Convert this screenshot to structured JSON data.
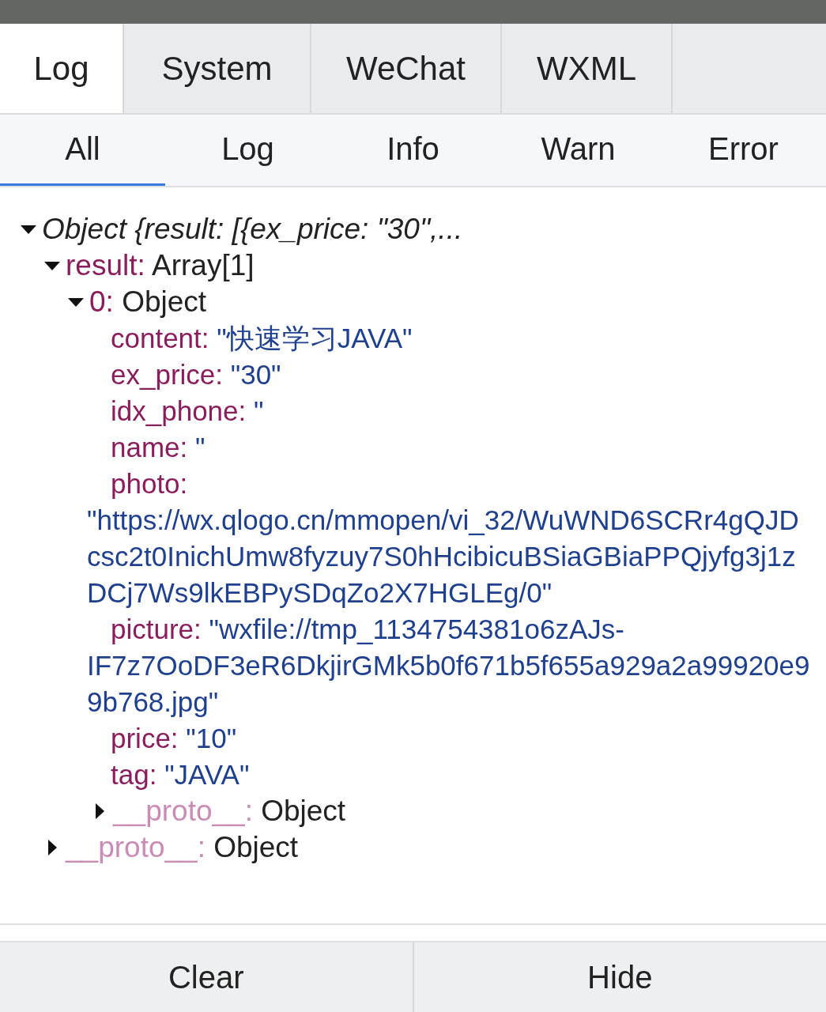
{
  "tabs": [
    {
      "label": "Log",
      "selected": true
    },
    {
      "label": "System",
      "selected": false
    },
    {
      "label": "WeChat",
      "selected": false
    },
    {
      "label": "WXML",
      "selected": false
    }
  ],
  "filters": [
    {
      "label": "All",
      "selected": true
    },
    {
      "label": "Log",
      "selected": false
    },
    {
      "label": "Info",
      "selected": false
    },
    {
      "label": "Warn",
      "selected": false
    },
    {
      "label": "Error",
      "selected": false
    }
  ],
  "console": [
    {
      "kind": "summary",
      "text": "Object {result: [{ex_price: \"30\",...",
      "expanded": true,
      "children": [
        {
          "kind": "object",
          "key": "result:",
          "value": "Array[1]",
          "expanded": true,
          "children": [
            {
              "kind": "object",
              "key": "0:",
              "value": "Object",
              "expanded": true,
              "children": [
                {
                  "kind": "property",
                  "key": "content:",
                  "value": "\"快速学习JAVA\""
                },
                {
                  "kind": "property",
                  "key": "ex_price:",
                  "value": "\"30\""
                },
                {
                  "kind": "property",
                  "key": "idx_phone:",
                  "value": "\""
                },
                {
                  "kind": "property",
                  "key": "name:",
                  "value": "\""
                },
                {
                  "kind": "property",
                  "key": "photo:",
                  "value": "\"https://wx.qlogo.cn/mmopen/vi_32/WuWND6SCRr4gQJDcsc2t0InichUmw8fyzuy7S0hHcibicuBSiaGBiaPPQjyfg3j1zDCj7Ws9lkEBPySDqZo2X7HGLEg/0\""
                },
                {
                  "kind": "property",
                  "key": "picture:",
                  "value": "\"wxfile://tmp_1134754381o6zAJs-IF7z7OoDF3eR6DkjirGMk5b0f671b5f655a929a2a99920e99b768.jpg\""
                },
                {
                  "kind": "property",
                  "key": "price:",
                  "value": "\"10\""
                },
                {
                  "kind": "property",
                  "key": "tag:",
                  "value": "\"JAVA\""
                },
                {
                  "kind": "proto",
                  "key": "__proto__:",
                  "value": "Object",
                  "expanded": false
                }
              ]
            }
          ]
        },
        {
          "kind": "proto",
          "key": "__proto__:",
          "value": "Object",
          "expanded": false
        }
      ]
    }
  ],
  "buttons": [
    "Clear",
    "Hide"
  ]
}
